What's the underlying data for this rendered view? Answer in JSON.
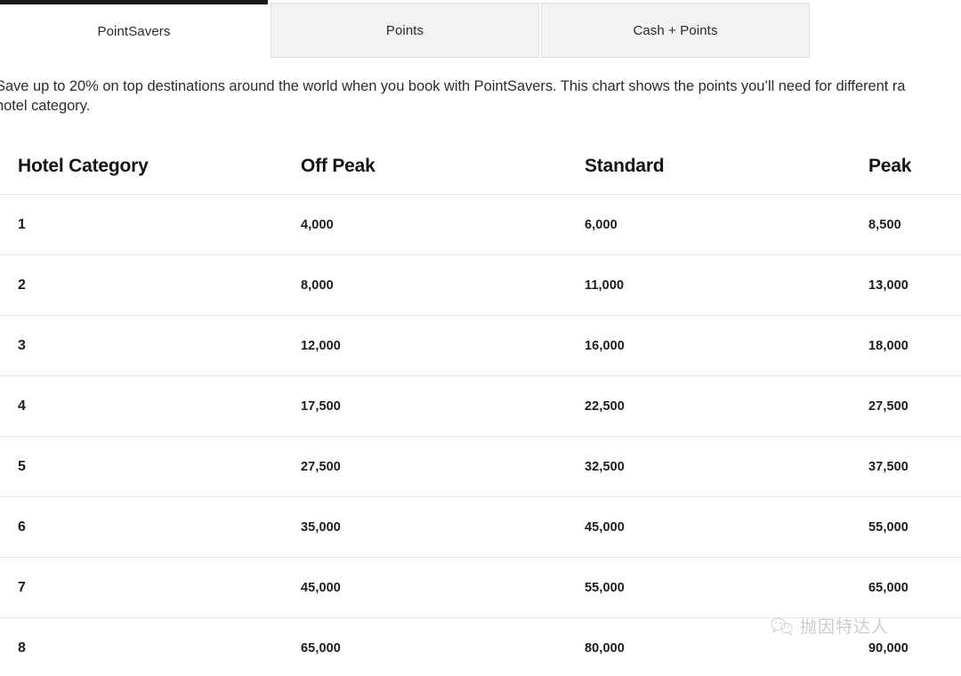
{
  "tabs": [
    {
      "label": "PointSavers",
      "active": true
    },
    {
      "label": "Points",
      "active": false
    },
    {
      "label": "Cash + Points",
      "active": false
    }
  ],
  "intro": {
    "text": "Save up to 20% on top destinations around the world when you book with PointSavers. This chart shows the points you’ll need for different ra\nhotel category."
  },
  "table": {
    "headers": [
      "Hotel Category",
      "Off Peak",
      "Standard",
      "Peak"
    ],
    "rows": [
      {
        "category": "1",
        "off_peak": "4,000",
        "standard": "6,000",
        "peak": "8,500"
      },
      {
        "category": "2",
        "off_peak": "8,000",
        "standard": "11,000",
        "peak": "13,000"
      },
      {
        "category": "3",
        "off_peak": "12,000",
        "standard": "16,000",
        "peak": "18,000"
      },
      {
        "category": "4",
        "off_peak": "17,500",
        "standard": "22,500",
        "peak": "27,500"
      },
      {
        "category": "5",
        "off_peak": "27,500",
        "standard": "32,500",
        "peak": "37,500"
      },
      {
        "category": "6",
        "off_peak": "35,000",
        "standard": "45,000",
        "peak": "55,000"
      },
      {
        "category": "7",
        "off_peak": "45,000",
        "standard": "55,000",
        "peak": "65,000"
      },
      {
        "category": "8",
        "off_peak": "65,000",
        "standard": "80,000",
        "peak": "90,000"
      }
    ]
  },
  "watermark": {
    "icon": "wechat-icon",
    "text": "抛因特达人"
  },
  "colors": {
    "active_tab_bar": "#1a1a1a",
    "inactive_tab_bg": "#f2f2f2",
    "row_divider": "#e6e6e6",
    "text": "#1d1d1d"
  }
}
